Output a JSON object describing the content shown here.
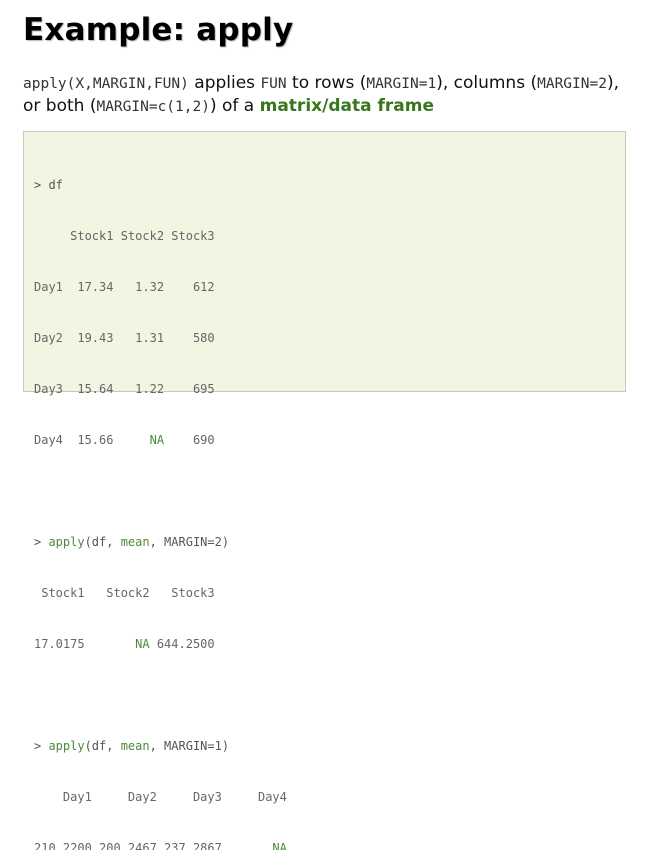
{
  "title": "Example: apply",
  "description": {
    "t1": "apply(X,MARGIN,FUN)",
    "t2": " applies ",
    "t3": "FUN",
    "t4": " to rows (",
    "t5": "MARGIN=1",
    "t6": "), columns (",
    "t7": "MARGIN=2",
    "t8": "), or both (",
    "t9": "MARGIN=c(1,2)",
    "t10": ") of a ",
    "t11": "matrix",
    "t12": "/",
    "t13": "data frame"
  },
  "console": {
    "cmd1": "> df",
    "df_header": "     Stock1 Stock2 Stock3",
    "df_rows": [
      {
        "pre": "Day1  17.34   1.32    612"
      },
      {
        "pre": "Day2  19.43   1.31    580"
      },
      {
        "pre": "Day3  15.64   1.22    695"
      },
      {
        "pre": "Day4  15.66     ",
        "na": "NA",
        "post": "    690"
      }
    ],
    "cmd2": {
      "prompt": "> ",
      "fn": "apply",
      "p1": "(df, ",
      "arg": "mean",
      "p2": ", MARGIN=2)"
    },
    "res2_header": " Stock1   Stock2   Stock3",
    "res2_values": {
      "pre": "17.0175       ",
      "na": "NA",
      "post": " 644.2500"
    },
    "cmd3": {
      "prompt": "> ",
      "fn": "apply",
      "p1": "(df, ",
      "arg": "mean",
      "p2": ", MARGIN=1)"
    },
    "res3_header": "    Day1     Day2     Day3     Day4",
    "res3_values": {
      "pre": "210.2200 200.2467 237.2867       ",
      "na": "NA"
    }
  },
  "colors": {
    "console_background": "#f4f4e2",
    "console_border": "#c9c9b8",
    "console_text": "#666666",
    "function_green": "#4f8a3b",
    "keyword_green": "#38761d"
  }
}
